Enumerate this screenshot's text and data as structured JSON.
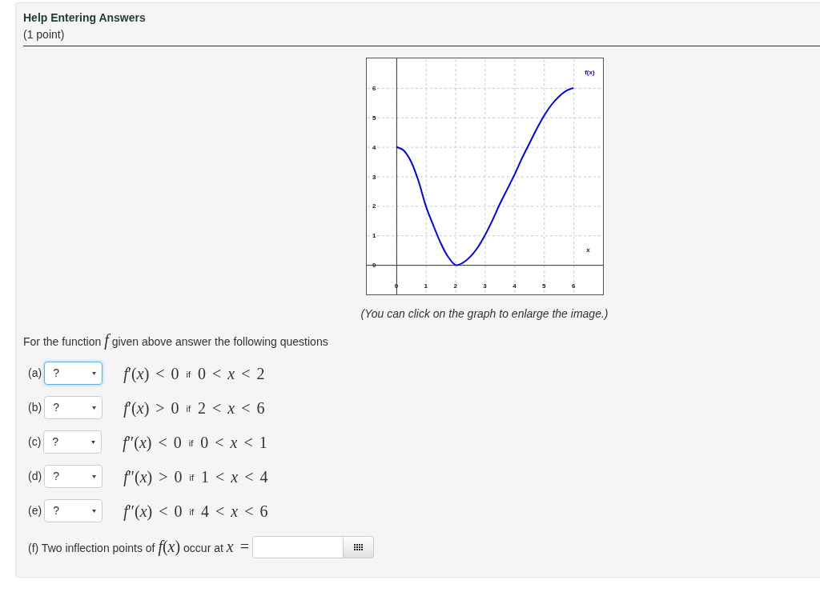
{
  "header": {
    "title": "Help Entering Answers",
    "points": "(1 point)"
  },
  "graph": {
    "chart_data": {
      "type": "line",
      "xlabel": "x",
      "x": [
        0,
        0.25,
        0.5,
        0.75,
        1,
        1.25,
        1.5,
        1.75,
        2,
        2.25,
        2.5,
        2.75,
        3,
        3.25,
        3.5,
        3.75,
        4,
        4.25,
        4.5,
        4.75,
        5,
        5.25,
        5.5,
        5.75,
        6
      ],
      "series": [
        {
          "name": "f(x)",
          "color": "#0000ff",
          "values": [
            4,
            3.88,
            3.5,
            2.85,
            2,
            1.35,
            0.75,
            0.28,
            0,
            0.07,
            0.27,
            0.58,
            1,
            1.5,
            2.05,
            2.55,
            3.05,
            3.6,
            4.1,
            4.6,
            5.05,
            5.42,
            5.7,
            5.9,
            6
          ]
        }
      ],
      "xlim": [
        -1,
        7
      ],
      "ylim": [
        -1,
        7
      ],
      "xticks": [
        0,
        1,
        2,
        3,
        4,
        5,
        6
      ],
      "yticks": [
        0,
        1,
        2,
        3,
        4,
        5,
        6
      ],
      "grid": true
    },
    "caption": "(You can click on the graph to enlarge the image.)"
  },
  "prompt": {
    "parts": [
      {
        "kind": "text",
        "text": "For the function"
      },
      {
        "kind": "var",
        "text": "f"
      },
      {
        "kind": "text",
        "text": "given above answer the following questions"
      }
    ]
  },
  "questions": [
    {
      "label": "(a)",
      "select": {
        "value": "?",
        "focused": true
      },
      "condition": "*f*′(*x*) < 0",
      "connector": "if",
      "interval": "0 < *x* < 2"
    },
    {
      "label": "(b)",
      "select": {
        "value": "?",
        "focused": false
      },
      "condition": "*f*′(*x*) > 0",
      "connector": "if",
      "interval": "2 < *x* < 6"
    },
    {
      "label": "(c)",
      "select": {
        "value": "?",
        "focused": false
      },
      "condition": "*f*″(*x*) < 0",
      "connector": "if",
      "interval": "0 < *x* < 1"
    },
    {
      "label": "(d)",
      "select": {
        "value": "?",
        "focused": false
      },
      "condition": "*f*″(*x*) > 0",
      "connector": "if",
      "interval": "1 < *x* < 4"
    },
    {
      "label": "(e)",
      "select": {
        "value": "?",
        "focused": false
      },
      "condition": "*f*″(*x*) < 0",
      "connector": "if",
      "interval": "4 < *x* < 6"
    }
  ],
  "final_question": {
    "parts": [
      {
        "kind": "text",
        "text": "(f) Two inflection points of"
      },
      {
        "kind": "math",
        "text": "*f*(*x*)"
      },
      {
        "kind": "text",
        "text": "occur at"
      },
      {
        "kind": "math",
        "text": "*x* ="
      }
    ]
  }
}
